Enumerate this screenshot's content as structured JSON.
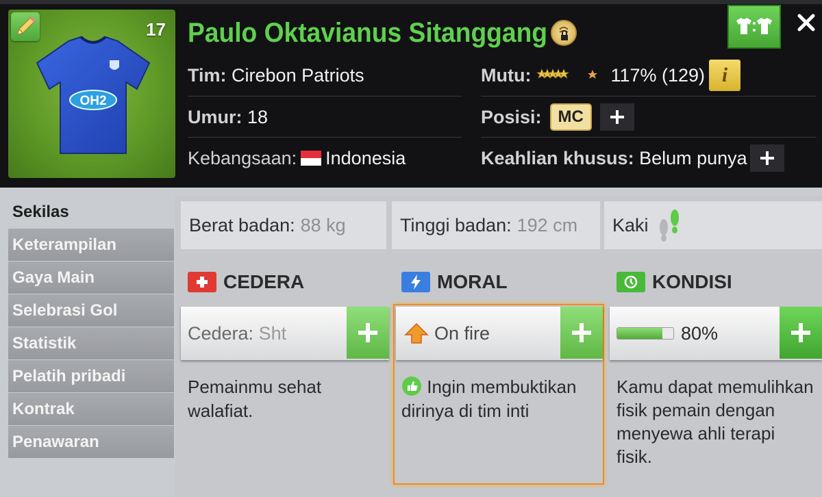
{
  "player": {
    "number": "17",
    "name": "Paulo Oktavianus Sitanggang",
    "jersey_sponsor": "OH2",
    "team_label": "Tim:",
    "team": "Cirebon Patriots",
    "age_label": "Umur:",
    "age": "18",
    "nationality_label": "Kebangsaan:",
    "nationality": "Indonesia",
    "quality_label": "Mutu:",
    "quality_value": "117% (129)",
    "quality_stars": 5.5,
    "position_label": "Posisi:",
    "position": "MC",
    "special_label": "Keahlian khusus:",
    "special": "Belum punya"
  },
  "sidebar": {
    "items": [
      {
        "label": "Sekilas",
        "active": true
      },
      {
        "label": "Keterampilan"
      },
      {
        "label": "Gaya Main"
      },
      {
        "label": "Selebrasi Gol"
      },
      {
        "label": "Statistik"
      },
      {
        "label": "Pelatih pribadi"
      },
      {
        "label": "Kontrak"
      },
      {
        "label": "Penawaran"
      }
    ]
  },
  "stats": {
    "weight_label": "Berat badan:",
    "weight": "88 kg",
    "height_label": "Tinggi badan:",
    "height": "192 cm",
    "foot_label": "Kaki"
  },
  "injury": {
    "title": "CEDERA",
    "status_label": "Cedera:",
    "status": "Sht",
    "description": "Pemainmu sehat walafiat."
  },
  "morale": {
    "title": "MORAL",
    "status": "On fire",
    "description": "Ingin membuktikan dirinya di tim inti"
  },
  "condition": {
    "title": "KONDISI",
    "percent_text": "80%",
    "fill_fraction": 0.8,
    "description": "Kamu dapat memulihkan fisik pemain dengan menyewa ahli terapi fisik."
  },
  "colors": {
    "accent_green": "#5fd04e",
    "injury_red": "#e03a32",
    "morale_blue": "#3a7ee0",
    "gold": "#e8c148"
  },
  "icons": [
    "pencil-icon",
    "lock-icon",
    "kit-icon",
    "close-icon",
    "info-icon",
    "plus-icon",
    "flag-icon",
    "footprints-icon",
    "first-aid-icon",
    "lightning-icon",
    "recovery-icon",
    "arrow-up-icon",
    "thumbs-up-icon"
  ]
}
